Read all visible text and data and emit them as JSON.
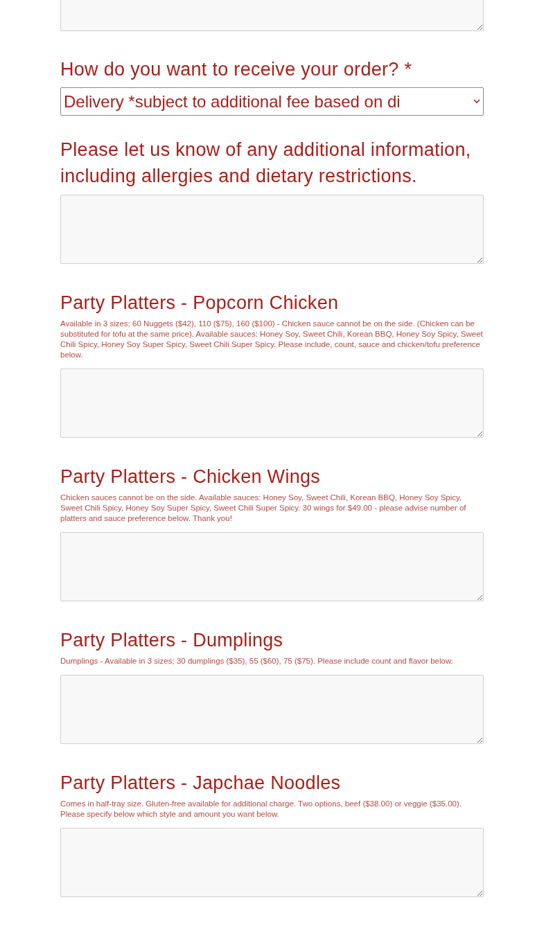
{
  "delivery_question": {
    "label": "How do you want to receive your order? *",
    "value": "Delivery *subject to additional fee based on di"
  },
  "additional_info": {
    "label": "Please let us know of any additional information, including allergies and dietary restrictions."
  },
  "platters": [
    {
      "title": "Party Platters - Popcorn Chicken",
      "description": "Available in 3 sizes; 60 Nuggets ($42), 110 ($75), 160 ($100) - Chicken sauce cannot be on the side. (Chicken can be substituted for tofu at the same price). Available sauces: Honey Soy, Sweet Chili, Korean BBQ, Honey Soy Spicy, Sweet Chili Spicy, Honey Soy Super Spicy, Sweet Chili Super Spicy. Please include, count, sauce and chicken/tofu preference below."
    },
    {
      "title": "Party Platters - Chicken Wings",
      "description": "Chicken sauces cannot be on the side. Available sauces: Honey Soy, Sweet Chili, Korean BBQ, Honey Soy Spicy, Sweet Chili Spicy, Honey Soy Super Spicy, Sweet Chili Super Spicy. 30 wings for $49.00 - please advise number of platters and sauce preference below. Thank you!"
    },
    {
      "title": "Party Platters - Dumplings",
      "description": "Dumplings - Available in 3 sizes; 30 dumplings ($35), 55 ($60), 75 ($75). Please include count and flavor below."
    },
    {
      "title": "Party Platters - Japchae Noodles",
      "description": "Comes in half-tray size. Gluten-free available for additional charge. Two options, beef ($38.00) or veggie ($35.00). Please specify below which style and amount you want below."
    }
  ]
}
